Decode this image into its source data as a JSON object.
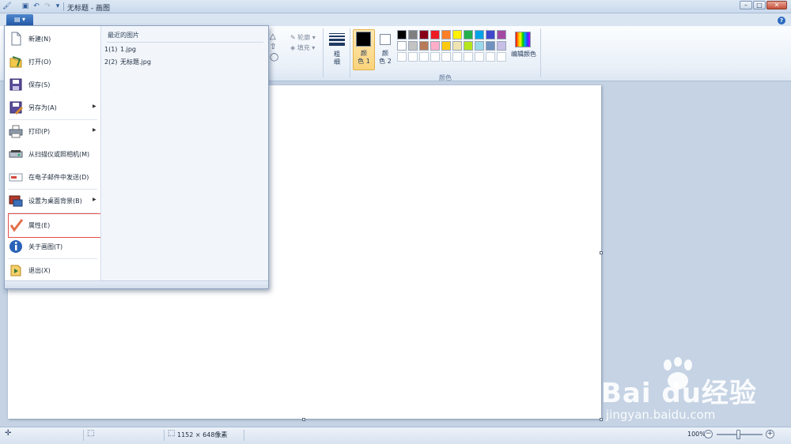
{
  "window": {
    "title": "无标题 - 画图",
    "controls": {
      "minimize": "–",
      "maximize": "□",
      "close": "✕"
    }
  },
  "ribbon": {
    "menu_button_label": "▤ ▾",
    "help": "?",
    "shapes_group": {
      "outline_label": "轮廓",
      "fill_label": "填充"
    },
    "size_label": "粗\n细",
    "color1_label": "颜\n色 1",
    "color2_label": "颜\n色 2",
    "edit_colors_label": "编辑颜色",
    "colors_group_caption": "颜色",
    "color1_value": "#000000",
    "color2_value": "#ffffff",
    "palette_row1": [
      "#000000",
      "#7f7f7f",
      "#880015",
      "#ed1c24",
      "#ff7f27",
      "#fff200",
      "#22b14c",
      "#00a2e8",
      "#3f48cc",
      "#a349a4"
    ],
    "palette_row2": [
      "#ffffff",
      "#c3c3c3",
      "#b97a57",
      "#ffaec9",
      "#ffc90e",
      "#efe4b0",
      "#b5e61d",
      "#99d9ea",
      "#7092be",
      "#c8bfe7"
    ],
    "palette_row3": [
      "#ffffff",
      "#ffffff",
      "#ffffff",
      "#ffffff",
      "#ffffff",
      "#ffffff",
      "#ffffff",
      "#ffffff",
      "#ffffff",
      "#ffffff"
    ]
  },
  "file_menu": {
    "items": [
      {
        "label": "新建(N)",
        "icon": "new-file-icon"
      },
      {
        "label": "打开(O)",
        "icon": "open-folder-icon"
      },
      {
        "label": "保存(S)",
        "icon": "save-disk-icon"
      },
      {
        "label": "另存为(A)",
        "icon": "save-as-icon",
        "arrow": "▶"
      },
      {
        "label": "打印(P)",
        "icon": "printer-icon",
        "arrow": "▶"
      },
      {
        "label": "从扫描仪或照相机(M)",
        "icon": "scanner-icon"
      },
      {
        "label": "在电子邮件中发送(D)",
        "icon": "email-icon"
      },
      {
        "label": "设置为桌面背景(B)",
        "icon": "desktop-background-icon",
        "arrow": "▶"
      },
      {
        "label": "属性(E)",
        "icon": "checkmark-icon"
      },
      {
        "label": "关于画图(T)",
        "icon": "info-icon"
      },
      {
        "label": "退出(X)",
        "icon": "exit-icon"
      }
    ],
    "recent_title": "最近的图片",
    "recent": [
      {
        "num": "1(1)",
        "name": "1.jpg"
      },
      {
        "num": "2(2)",
        "name": "无标题.jpg"
      }
    ]
  },
  "statusbar": {
    "add_icon": "✛",
    "selection_icon": "⬚",
    "size_icon": "⬚",
    "dimensions": "1152 × 648像素",
    "zoom": "100%",
    "zoom_out": "−",
    "zoom_in": "+"
  },
  "watermark": {
    "brand": "Bai du经验",
    "url": "jingyan.baidu.com"
  }
}
